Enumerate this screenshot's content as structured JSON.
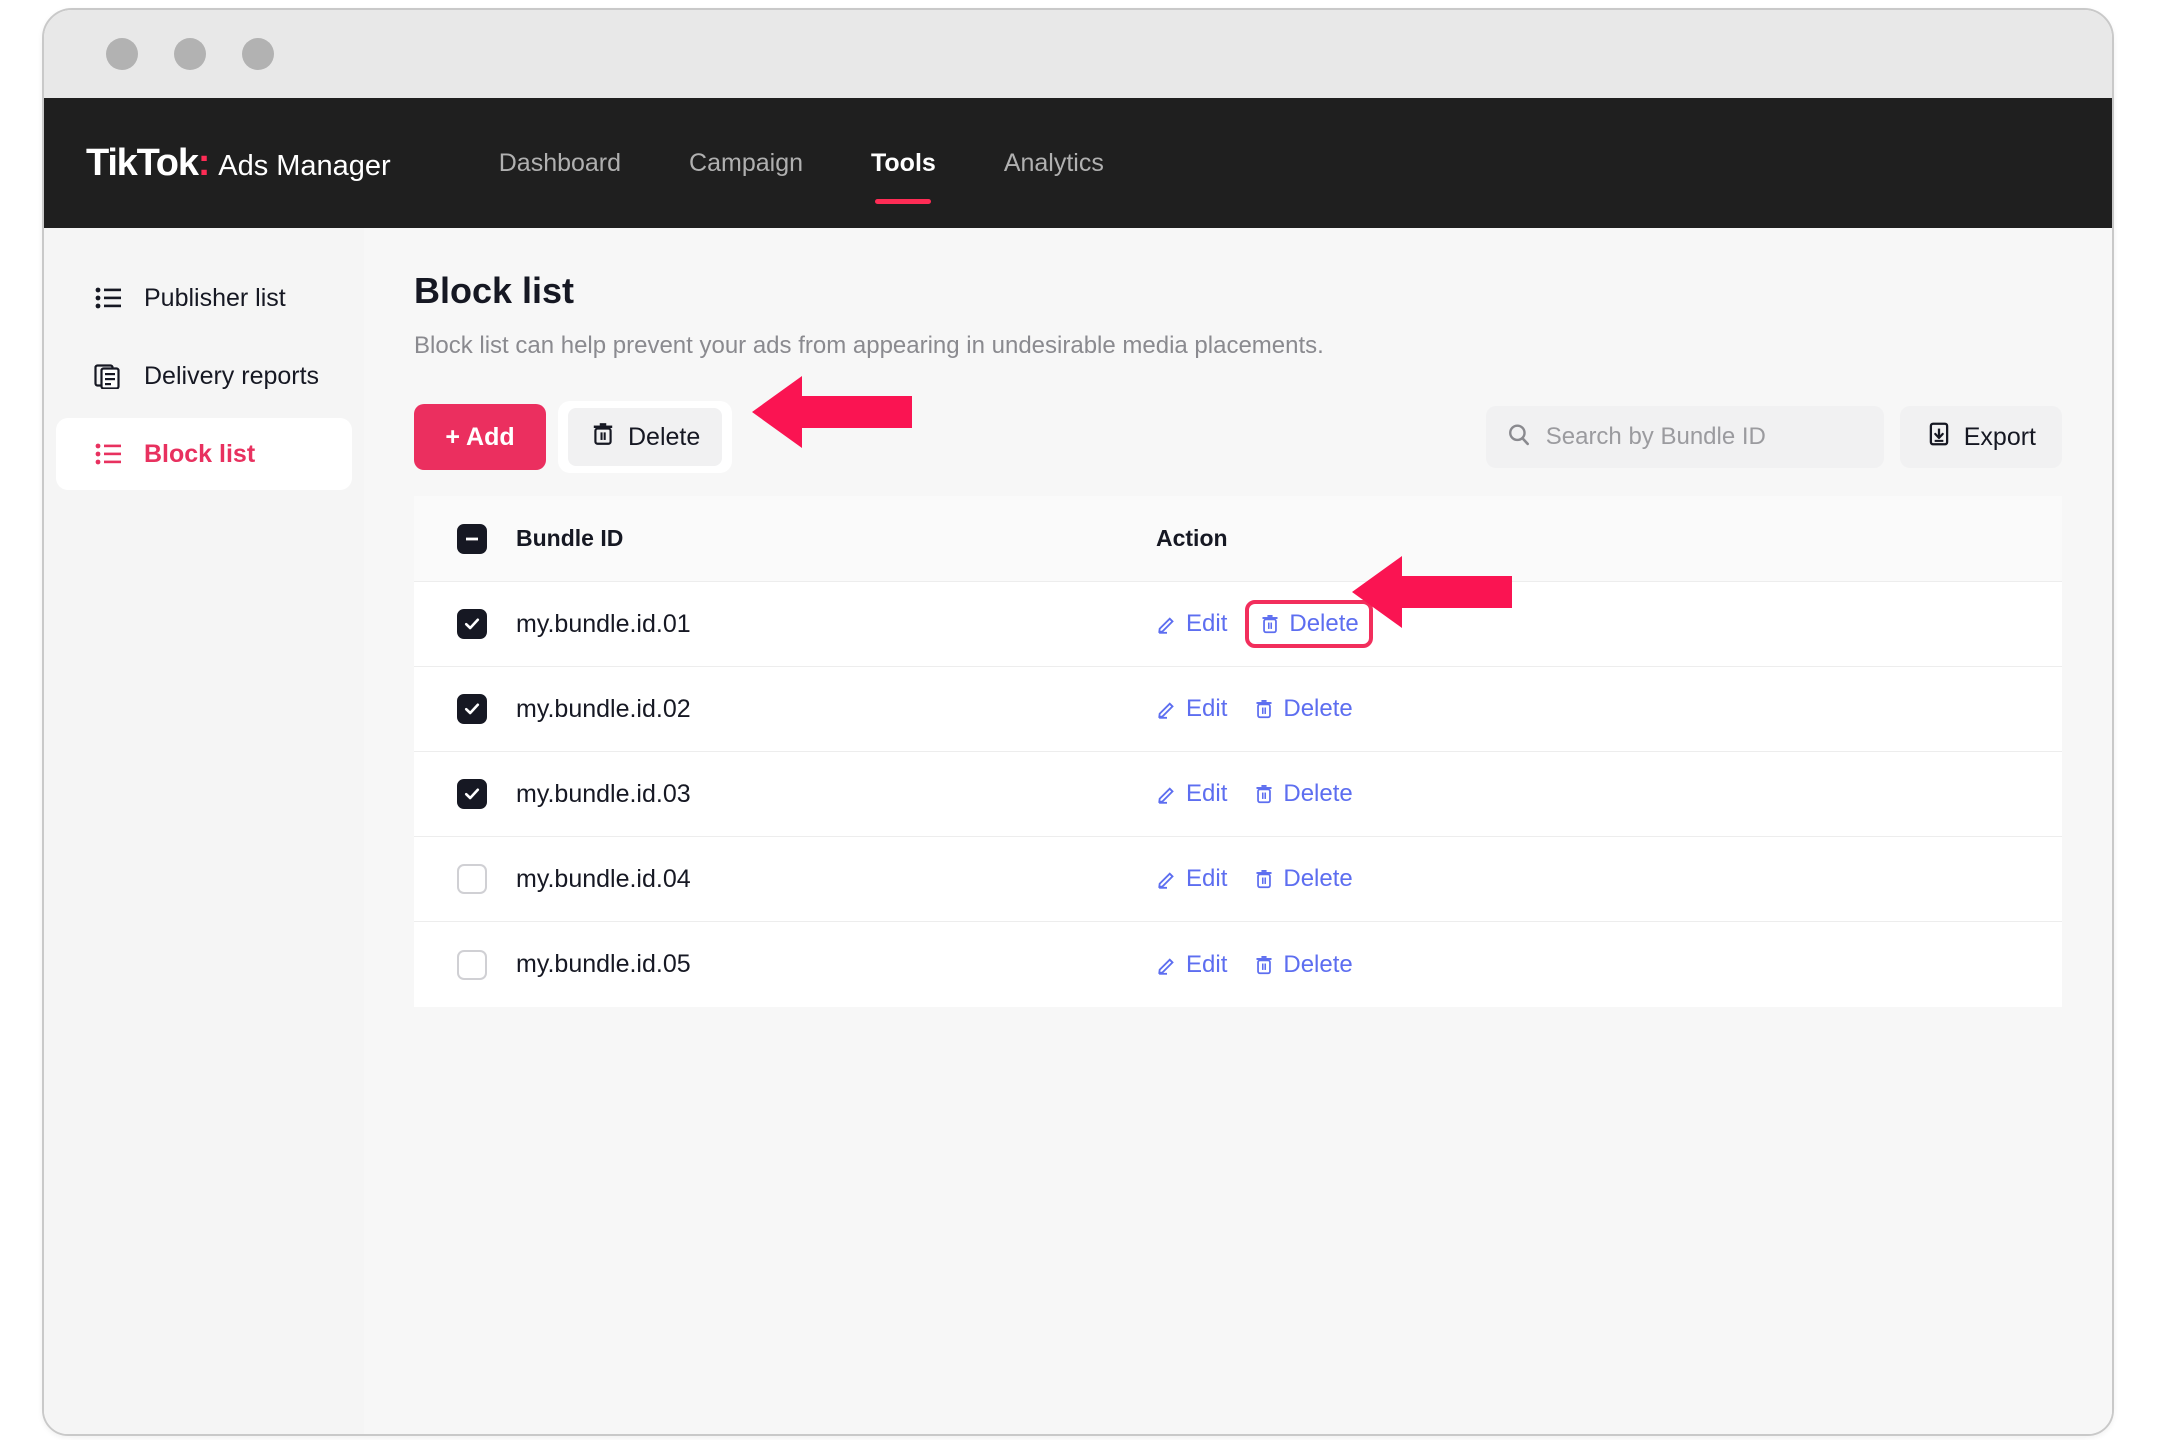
{
  "window": {
    "traffic_lights": [
      "close",
      "minimize",
      "maximize"
    ]
  },
  "topnav": {
    "brand_logo": "TikTok",
    "brand_colon": ":",
    "brand_sub": "Ads Manager",
    "items": [
      {
        "label": "Dashboard",
        "active": false
      },
      {
        "label": "Campaign",
        "active": false
      },
      {
        "label": "Tools",
        "active": true
      },
      {
        "label": "Analytics",
        "active": false
      }
    ],
    "accent_color": "#fe2c55"
  },
  "sidebar": {
    "items": [
      {
        "label": "Publisher list",
        "icon": "list-dots-icon",
        "active": false
      },
      {
        "label": "Delivery reports",
        "icon": "document-copy-icon",
        "active": false
      },
      {
        "label": "Block list",
        "icon": "list-dots-icon",
        "active": true
      }
    ],
    "active_color": "#e8315f"
  },
  "main": {
    "title": "Block list",
    "description": "Block list can help prevent your ads from appearing in undesirable media placements.",
    "toolbar": {
      "add_label": "+ Add",
      "delete_label": "Delete",
      "delete_icon": "trash-icon",
      "export_label": "Export",
      "export_icon": "export-file-icon",
      "search_icon": "search-icon",
      "search_value": "",
      "search_placeholder": "Search by Bundle ID",
      "add_color": "#eb2f5f",
      "highlight_color": "#f22e5c"
    },
    "table": {
      "columns": [
        {
          "key": "bundle",
          "label": "Bundle ID"
        },
        {
          "key": "action",
          "label": "Action"
        }
      ],
      "header_checkbox_state": "indeterminate",
      "row_action_labels": {
        "edit": "Edit",
        "delete": "Delete"
      },
      "row_action_icons": {
        "edit": "pencil-icon",
        "delete": "trash-icon"
      },
      "action_link_color": "#5d6ef0",
      "rows": [
        {
          "bundle": "my.bundle.id.01",
          "checked": true,
          "delete_highlighted": true
        },
        {
          "bundle": "my.bundle.id.02",
          "checked": true,
          "delete_highlighted": false
        },
        {
          "bundle": "my.bundle.id.03",
          "checked": true,
          "delete_highlighted": false
        },
        {
          "bundle": "my.bundle.id.04",
          "checked": false,
          "delete_highlighted": false
        },
        {
          "bundle": "my.bundle.id.05",
          "checked": false,
          "delete_highlighted": false
        }
      ]
    }
  },
  "annotations": {
    "color": "#fa1452",
    "arrows": [
      {
        "name": "arrow-to-delete-button",
        "direction": "left"
      },
      {
        "name": "arrow-to-row-delete-link",
        "direction": "left"
      }
    ]
  }
}
